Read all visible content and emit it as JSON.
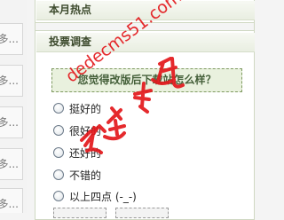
{
  "left_column": {
    "items": [
      "多...",
      "多...",
      "多...",
      "多...",
      "多..."
    ]
  },
  "hot_section": {
    "title": "本月热点"
  },
  "vote_section": {
    "title": "投票调查",
    "question": "您觉得改版后下载站怎么样？",
    "options": [
      "挺好的",
      "很好的",
      "还好的",
      "不错的",
      "以上四点 (-_-)"
    ]
  },
  "watermark": {
    "url_text": "dedecms51.com",
    "brand_colors": {
      "red": "#e3181c"
    }
  },
  "colors": {
    "panel_border": "#cfd8c2",
    "question_bg": "#e9f1de",
    "question_border": "#7f9a61",
    "heading_text": "#3c4a2c"
  }
}
